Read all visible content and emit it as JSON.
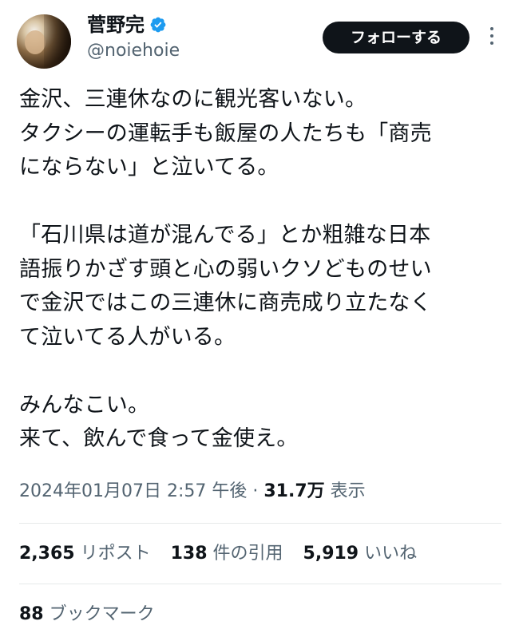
{
  "author": {
    "display_name": "菅野完",
    "handle": "@noiehoie",
    "verified": true,
    "verified_color": "#1d9bf0"
  },
  "actions": {
    "follow_label": "フォローする",
    "more_icon": "more-vertical-icon"
  },
  "tweet": {
    "lines": [
      "金沢、三連休なのに観光客いない。",
      "タクシーの運転手も飯屋の人たちも「商売",
      "にならない」と泣いてる。",
      "",
      "「石川県は道が混んでる」とか粗雑な日本",
      "語振りかざす頭と心の弱いクソどものせい",
      "で金沢ではこの三連休に商売成り立たなく",
      "て泣いてる人がいる。",
      "",
      "みんなこい。",
      "来て、飲んで食って金使え。"
    ]
  },
  "meta": {
    "timestamp": "2024年01月07日 2:57 午後",
    "separator": " · ",
    "views_count": "31.7万",
    "views_label": " 表示"
  },
  "stats": {
    "reposts_count": "2,365",
    "reposts_label": " リポスト",
    "quotes_count": "138",
    "quotes_label": " 件の引用",
    "likes_count": "5,919",
    "likes_label": " いいね",
    "bookmarks_count": "88",
    "bookmarks_label": " ブックマーク"
  },
  "colors": {
    "text_primary": "#0f1419",
    "text_secondary": "#536471",
    "divider": "#e6e9ea",
    "follow_button_bg": "#0f1419"
  }
}
